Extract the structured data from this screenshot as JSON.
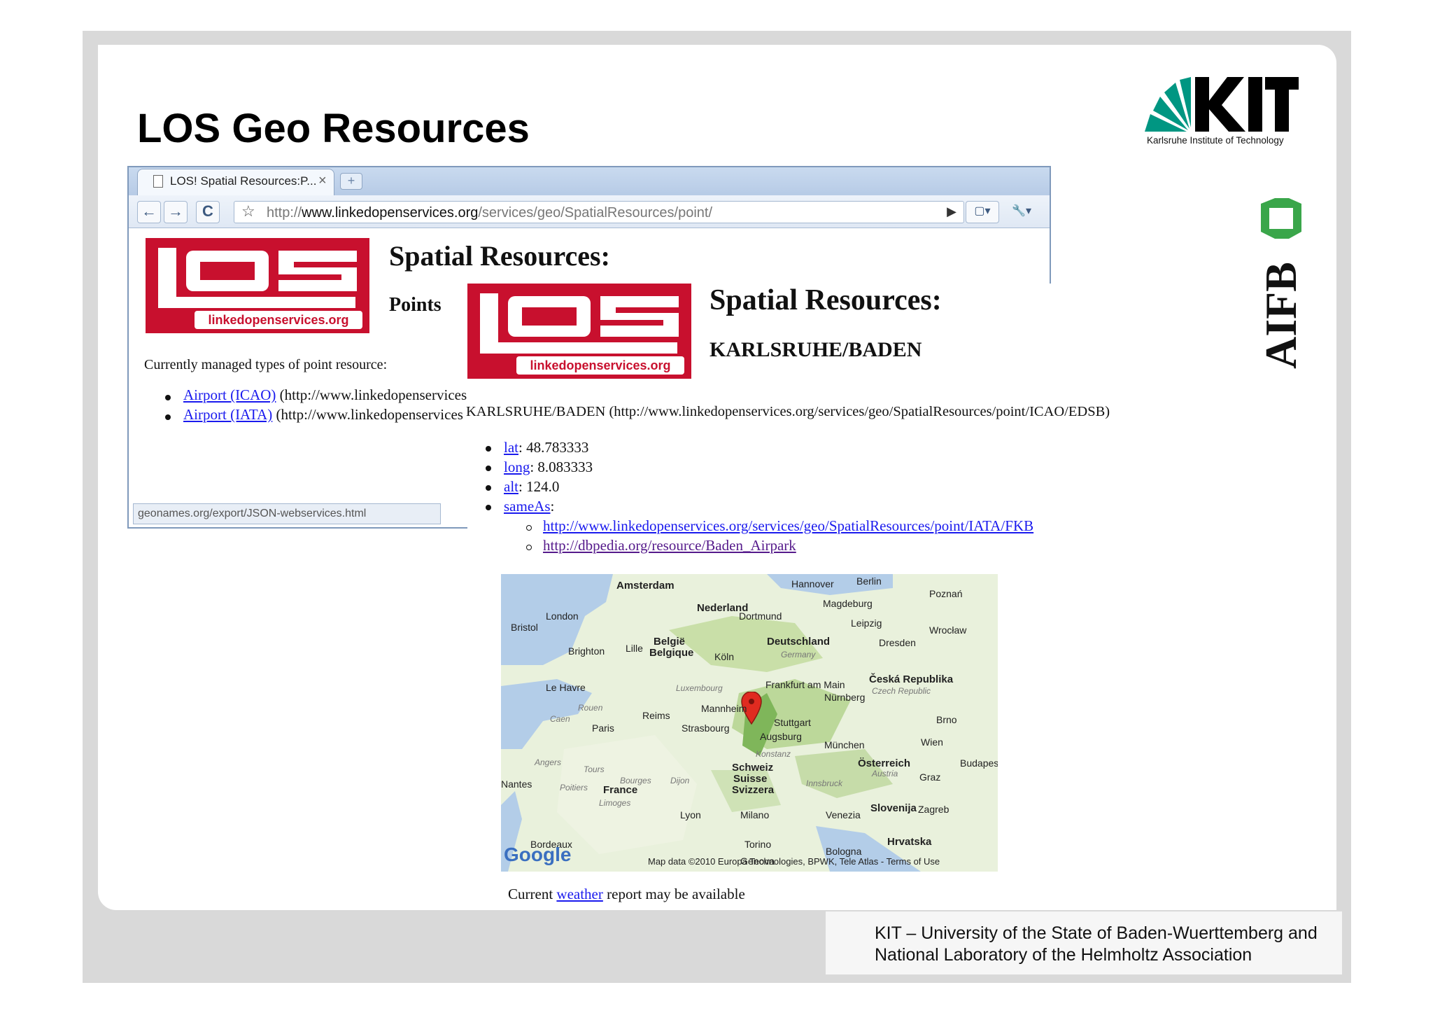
{
  "slide": {
    "title": "LOS Geo Resources",
    "kit_caption": "Karlsruhe Institute of Technology",
    "footer_line1": "KIT – University of the State of Baden-Wuerttemberg and",
    "footer_line2": "National Laboratory of the Helmholtz Association"
  },
  "browser": {
    "tab_label": "LOS! Spatial Resources:P...",
    "tab_close": "×",
    "new_tab": "+",
    "back": "←",
    "forward": "→",
    "reload": "C",
    "star": "☆",
    "url_prefix": "http://",
    "url_host": "www.linkedopenservices.org",
    "url_path": "/services/geo/SpatialResources/point/",
    "go": "▶",
    "page_menu": "▢▾",
    "tools_menu": "🔧▾",
    "status_url": "geonames.org/export/JSON-webservices.html"
  },
  "page1": {
    "logo_text": "linkedopenservices.org",
    "heading": "Spatial Resources:",
    "subheading": "Points",
    "intro": "Currently managed types of point resource:",
    "items": [
      {
        "link": "Airport (ICAO)",
        "rest": " (http://www.linkedopenservices"
      },
      {
        "link": "Airport (IATA)",
        "rest": " (http://www.linkedopenservices"
      }
    ]
  },
  "page2": {
    "logo_text": "linkedopenservices.org",
    "heading": "Spatial Resources:",
    "subheading": "KARLSRUHE/BADEN",
    "resource_line": "KARLSRUHE/BADEN (http://www.linkedopenservices.org/services/geo/SpatialResources/point/ICAO/EDSB)",
    "props": [
      {
        "link": "lat",
        "value": ": 48.783333"
      },
      {
        "link": "long",
        "value": ": 8.083333"
      },
      {
        "link": "alt",
        "value": ": 124.0"
      },
      {
        "link": "sameAs",
        "value": ":"
      }
    ],
    "same_as": [
      "http://www.linkedopenservices.org/services/geo/SpatialResources/point/IATA/FKB",
      "http://dbpedia.org/resource/Baden_Airpark"
    ],
    "weather_prefix": "Current ",
    "weather_link": "weather",
    "weather_suffix": " report may be available"
  },
  "map": {
    "credit": "Map data ©2010 Europa Technologies, BPWK, Tele Atlas - Terms of Use",
    "google": "Google",
    "labels": [
      "Amsterdam",
      "Nederland",
      "London",
      "Bristol",
      "Brighton",
      "Lille",
      "België",
      "Belgique",
      "Köln",
      "Dortmund",
      "Deutschland",
      "Germany",
      "Hannover",
      "Berlin",
      "Magdeburg",
      "Leipzig",
      "Dresden",
      "Poznań",
      "Wrocław",
      "Frankfurt am Main",
      "Nürnberg",
      "Česká Republika",
      "Czech Republic",
      "Mannheim",
      "Stuttgart",
      "Augsburg",
      "München",
      "Strasbourg",
      "Paris",
      "Reims",
      "Le Havre",
      "Rouen",
      "Caen",
      "Luxembourg",
      "Schweiz",
      "Suisse",
      "Svizzera",
      "France",
      "Lyon",
      "Milano",
      "Torino",
      "Genova",
      "Venezia",
      "Bologna",
      "Österreich",
      "Austria",
      "Wien",
      "Graz",
      "Brno",
      "Slovenija",
      "Zagreb",
      "Hrvatska",
      "Bordeaux",
      "Nantes",
      "Tours",
      "Angers",
      "Bourges",
      "Dijon",
      "Limoges",
      "Poitiers",
      "Konstanz",
      "Innsbruck",
      "Budapest"
    ]
  }
}
